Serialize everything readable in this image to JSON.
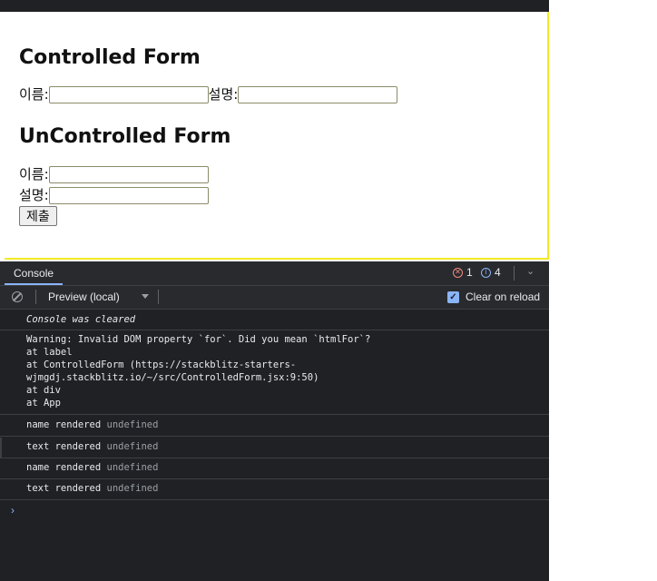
{
  "preview": {
    "controlled_title": "Controlled Form",
    "uncontrolled_title": "UnControlled Form",
    "name_label": "이름:",
    "desc_label": "설명:",
    "submit_label": "제출"
  },
  "devtools": {
    "tab_console": "Console",
    "error_count": "1",
    "info_count": "4",
    "context": "Preview (local)",
    "clear_on_reload": "Clear on reload",
    "clear_on_reload_checked": true
  },
  "console_logs": [
    {
      "text": "Console was cleared"
    },
    {
      "lines": [
        "Warning: Invalid DOM property `for`. Did you mean `htmlFor`?",
        "at label",
        "at ControlledForm (https://stackblitz-starters-",
        "wjmgdj.stackblitz.io/~/src/ControlledForm.jsx:9:50)",
        "at div",
        "at App"
      ]
    },
    {
      "msg": "name rendered",
      "val": "undefined"
    },
    {
      "msg": "text rendered",
      "val": "undefined"
    },
    {
      "msg": "name rendered",
      "val": "undefined"
    },
    {
      "msg": "text rendered",
      "val": "undefined"
    }
  ],
  "icons": {
    "error": "error-circle-icon",
    "info": "info-circle-icon",
    "clear": "clear-console-icon",
    "prompt": "chevron-right-icon"
  },
  "colors": {
    "accent": "#8ab4f8",
    "error": "#f28b82",
    "highlight": "#f3ea24"
  }
}
